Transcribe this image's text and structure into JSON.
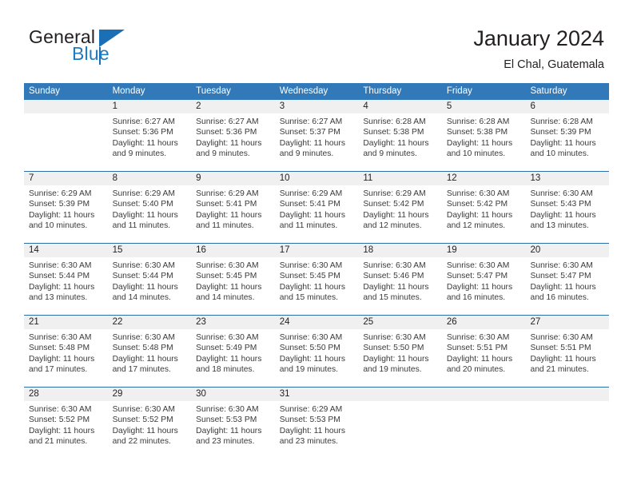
{
  "brand": {
    "name_part1": "General",
    "name_part2": "Blue",
    "logo_icon": "blue-triangle-flag-icon",
    "accent_color": "#1a6fb5"
  },
  "header": {
    "title": "January 2024",
    "subtitle": "El Chal, Guatemala"
  },
  "calendar": {
    "header_bg_color": "#3179b8",
    "weekdays": [
      "Sunday",
      "Monday",
      "Tuesday",
      "Wednesday",
      "Thursday",
      "Friday",
      "Saturday"
    ],
    "weeks": [
      [
        {
          "day": "",
          "lines": []
        },
        {
          "day": "1",
          "lines": [
            "Sunrise: 6:27 AM",
            "Sunset: 5:36 PM",
            "Daylight: 11 hours",
            "and 9 minutes."
          ]
        },
        {
          "day": "2",
          "lines": [
            "Sunrise: 6:27 AM",
            "Sunset: 5:36 PM",
            "Daylight: 11 hours",
            "and 9 minutes."
          ]
        },
        {
          "day": "3",
          "lines": [
            "Sunrise: 6:27 AM",
            "Sunset: 5:37 PM",
            "Daylight: 11 hours",
            "and 9 minutes."
          ]
        },
        {
          "day": "4",
          "lines": [
            "Sunrise: 6:28 AM",
            "Sunset: 5:38 PM",
            "Daylight: 11 hours",
            "and 9 minutes."
          ]
        },
        {
          "day": "5",
          "lines": [
            "Sunrise: 6:28 AM",
            "Sunset: 5:38 PM",
            "Daylight: 11 hours",
            "and 10 minutes."
          ]
        },
        {
          "day": "6",
          "lines": [
            "Sunrise: 6:28 AM",
            "Sunset: 5:39 PM",
            "Daylight: 11 hours",
            "and 10 minutes."
          ]
        }
      ],
      [
        {
          "day": "7",
          "lines": [
            "Sunrise: 6:29 AM",
            "Sunset: 5:39 PM",
            "Daylight: 11 hours",
            "and 10 minutes."
          ]
        },
        {
          "day": "8",
          "lines": [
            "Sunrise: 6:29 AM",
            "Sunset: 5:40 PM",
            "Daylight: 11 hours",
            "and 11 minutes."
          ]
        },
        {
          "day": "9",
          "lines": [
            "Sunrise: 6:29 AM",
            "Sunset: 5:41 PM",
            "Daylight: 11 hours",
            "and 11 minutes."
          ]
        },
        {
          "day": "10",
          "lines": [
            "Sunrise: 6:29 AM",
            "Sunset: 5:41 PM",
            "Daylight: 11 hours",
            "and 11 minutes."
          ]
        },
        {
          "day": "11",
          "lines": [
            "Sunrise: 6:29 AM",
            "Sunset: 5:42 PM",
            "Daylight: 11 hours",
            "and 12 minutes."
          ]
        },
        {
          "day": "12",
          "lines": [
            "Sunrise: 6:30 AM",
            "Sunset: 5:42 PM",
            "Daylight: 11 hours",
            "and 12 minutes."
          ]
        },
        {
          "day": "13",
          "lines": [
            "Sunrise: 6:30 AM",
            "Sunset: 5:43 PM",
            "Daylight: 11 hours",
            "and 13 minutes."
          ]
        }
      ],
      [
        {
          "day": "14",
          "lines": [
            "Sunrise: 6:30 AM",
            "Sunset: 5:44 PM",
            "Daylight: 11 hours",
            "and 13 minutes."
          ]
        },
        {
          "day": "15",
          "lines": [
            "Sunrise: 6:30 AM",
            "Sunset: 5:44 PM",
            "Daylight: 11 hours",
            "and 14 minutes."
          ]
        },
        {
          "day": "16",
          "lines": [
            "Sunrise: 6:30 AM",
            "Sunset: 5:45 PM",
            "Daylight: 11 hours",
            "and 14 minutes."
          ]
        },
        {
          "day": "17",
          "lines": [
            "Sunrise: 6:30 AM",
            "Sunset: 5:45 PM",
            "Daylight: 11 hours",
            "and 15 minutes."
          ]
        },
        {
          "day": "18",
          "lines": [
            "Sunrise: 6:30 AM",
            "Sunset: 5:46 PM",
            "Daylight: 11 hours",
            "and 15 minutes."
          ]
        },
        {
          "day": "19",
          "lines": [
            "Sunrise: 6:30 AM",
            "Sunset: 5:47 PM",
            "Daylight: 11 hours",
            "and 16 minutes."
          ]
        },
        {
          "day": "20",
          "lines": [
            "Sunrise: 6:30 AM",
            "Sunset: 5:47 PM",
            "Daylight: 11 hours",
            "and 16 minutes."
          ]
        }
      ],
      [
        {
          "day": "21",
          "lines": [
            "Sunrise: 6:30 AM",
            "Sunset: 5:48 PM",
            "Daylight: 11 hours",
            "and 17 minutes."
          ]
        },
        {
          "day": "22",
          "lines": [
            "Sunrise: 6:30 AM",
            "Sunset: 5:48 PM",
            "Daylight: 11 hours",
            "and 17 minutes."
          ]
        },
        {
          "day": "23",
          "lines": [
            "Sunrise: 6:30 AM",
            "Sunset: 5:49 PM",
            "Daylight: 11 hours",
            "and 18 minutes."
          ]
        },
        {
          "day": "24",
          "lines": [
            "Sunrise: 6:30 AM",
            "Sunset: 5:50 PM",
            "Daylight: 11 hours",
            "and 19 minutes."
          ]
        },
        {
          "day": "25",
          "lines": [
            "Sunrise: 6:30 AM",
            "Sunset: 5:50 PM",
            "Daylight: 11 hours",
            "and 19 minutes."
          ]
        },
        {
          "day": "26",
          "lines": [
            "Sunrise: 6:30 AM",
            "Sunset: 5:51 PM",
            "Daylight: 11 hours",
            "and 20 minutes."
          ]
        },
        {
          "day": "27",
          "lines": [
            "Sunrise: 6:30 AM",
            "Sunset: 5:51 PM",
            "Daylight: 11 hours",
            "and 21 minutes."
          ]
        }
      ],
      [
        {
          "day": "28",
          "lines": [
            "Sunrise: 6:30 AM",
            "Sunset: 5:52 PM",
            "Daylight: 11 hours",
            "and 21 minutes."
          ]
        },
        {
          "day": "29",
          "lines": [
            "Sunrise: 6:30 AM",
            "Sunset: 5:52 PM",
            "Daylight: 11 hours",
            "and 22 minutes."
          ]
        },
        {
          "day": "30",
          "lines": [
            "Sunrise: 6:30 AM",
            "Sunset: 5:53 PM",
            "Daylight: 11 hours",
            "and 23 minutes."
          ]
        },
        {
          "day": "31",
          "lines": [
            "Sunrise: 6:29 AM",
            "Sunset: 5:53 PM",
            "Daylight: 11 hours",
            "and 23 minutes."
          ]
        },
        {
          "day": "",
          "lines": []
        },
        {
          "day": "",
          "lines": []
        },
        {
          "day": "",
          "lines": []
        }
      ]
    ]
  }
}
